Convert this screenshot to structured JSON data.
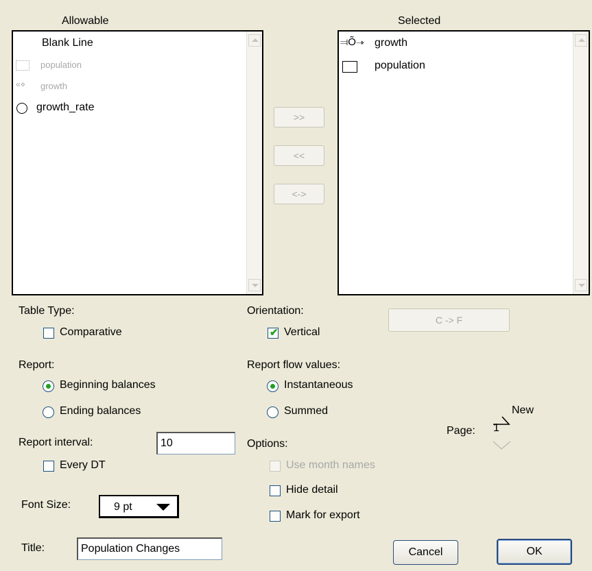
{
  "allowable": {
    "header": "Allowable",
    "items": [
      {
        "label": "Blank Line",
        "icon": "none",
        "enabled": true
      },
      {
        "label": "population",
        "icon": "stock-icon",
        "enabled": false
      },
      {
        "label": "growth",
        "icon": "flow-icon",
        "enabled": false
      },
      {
        "label": "growth_rate",
        "icon": "converter-icon",
        "enabled": true
      }
    ]
  },
  "selected": {
    "header": "Selected",
    "items": [
      {
        "label": "growth",
        "icon": "flow-icon"
      },
      {
        "label": "population",
        "icon": "stock-icon"
      }
    ]
  },
  "transfer": {
    "add_label": ">>",
    "remove_label": "<<",
    "swap_label": "<->",
    "convert_label": "C -> F"
  },
  "table_type": {
    "heading": "Table Type:",
    "comparative_label": "Comparative",
    "comparative_checked": false
  },
  "orientation": {
    "heading": "Orientation:",
    "vertical_label": "Vertical",
    "vertical_checked": true
  },
  "report": {
    "heading": "Report:",
    "options": [
      "Beginning balances",
      "Ending balances"
    ],
    "selected": "Beginning balances"
  },
  "flow_values": {
    "heading": "Report flow values:",
    "options": [
      "Instantaneous",
      "Summed"
    ],
    "selected": "Instantaneous"
  },
  "interval": {
    "label": "Report interval:",
    "value": "10",
    "every_dt_label": "Every DT",
    "every_dt_checked": false
  },
  "options": {
    "heading": "Options:",
    "month_names_label": "Use month names",
    "hide_detail_label": "Hide detail",
    "mark_export_label": "Mark for export"
  },
  "page": {
    "label": "Page:",
    "value": "1",
    "new_label": "New"
  },
  "font_size": {
    "label": "Font Size:",
    "value": "9 pt"
  },
  "title": {
    "label": "Title:",
    "value": "Population Changes"
  },
  "actions": {
    "cancel_label": "Cancel",
    "ok_label": "OK"
  }
}
